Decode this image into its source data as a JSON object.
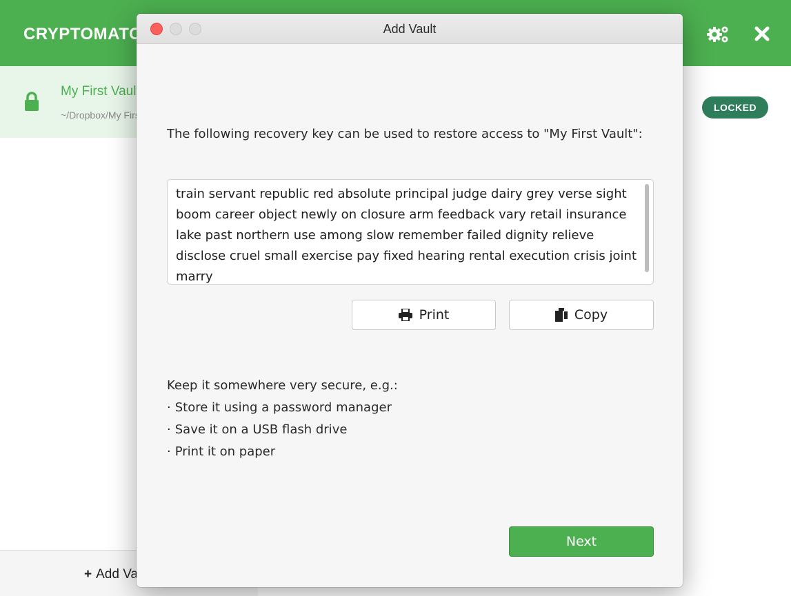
{
  "app": {
    "title": "CRYPTOMATOR",
    "settings_icon": "gears-icon",
    "close_icon": "close-icon"
  },
  "sidebar": {
    "vault": {
      "name": "My First Vault",
      "path": "~/Dropbox/My First Vault",
      "icon": "lock-icon",
      "status": "LOCKED"
    },
    "add_vault_label": "Add Vault"
  },
  "dialog": {
    "title": "Add Vault",
    "intro": "The following recovery key can be used to restore access to \"My First Vault\":",
    "recovery_key": "train servant republic red absolute principal judge dairy grey verse sight boom career object newly on closure arm feedback vary retail insurance lake past northern use among slow remember failed dignity relieve disclose cruel small exercise pay fixed hearing rental execution crisis joint marry",
    "print_label": "Print",
    "copy_label": "Copy",
    "secure_heading": "Keep it somewhere very secure, e.g.:",
    "secure_items": [
      "Store it using a password manager",
      "Save it on a USB flash drive",
      "Print it on paper"
    ],
    "next_label": "Next"
  },
  "colors": {
    "brand_green": "#4caf50",
    "badge_green": "#2e7d5b",
    "close_red": "#fc605b"
  }
}
